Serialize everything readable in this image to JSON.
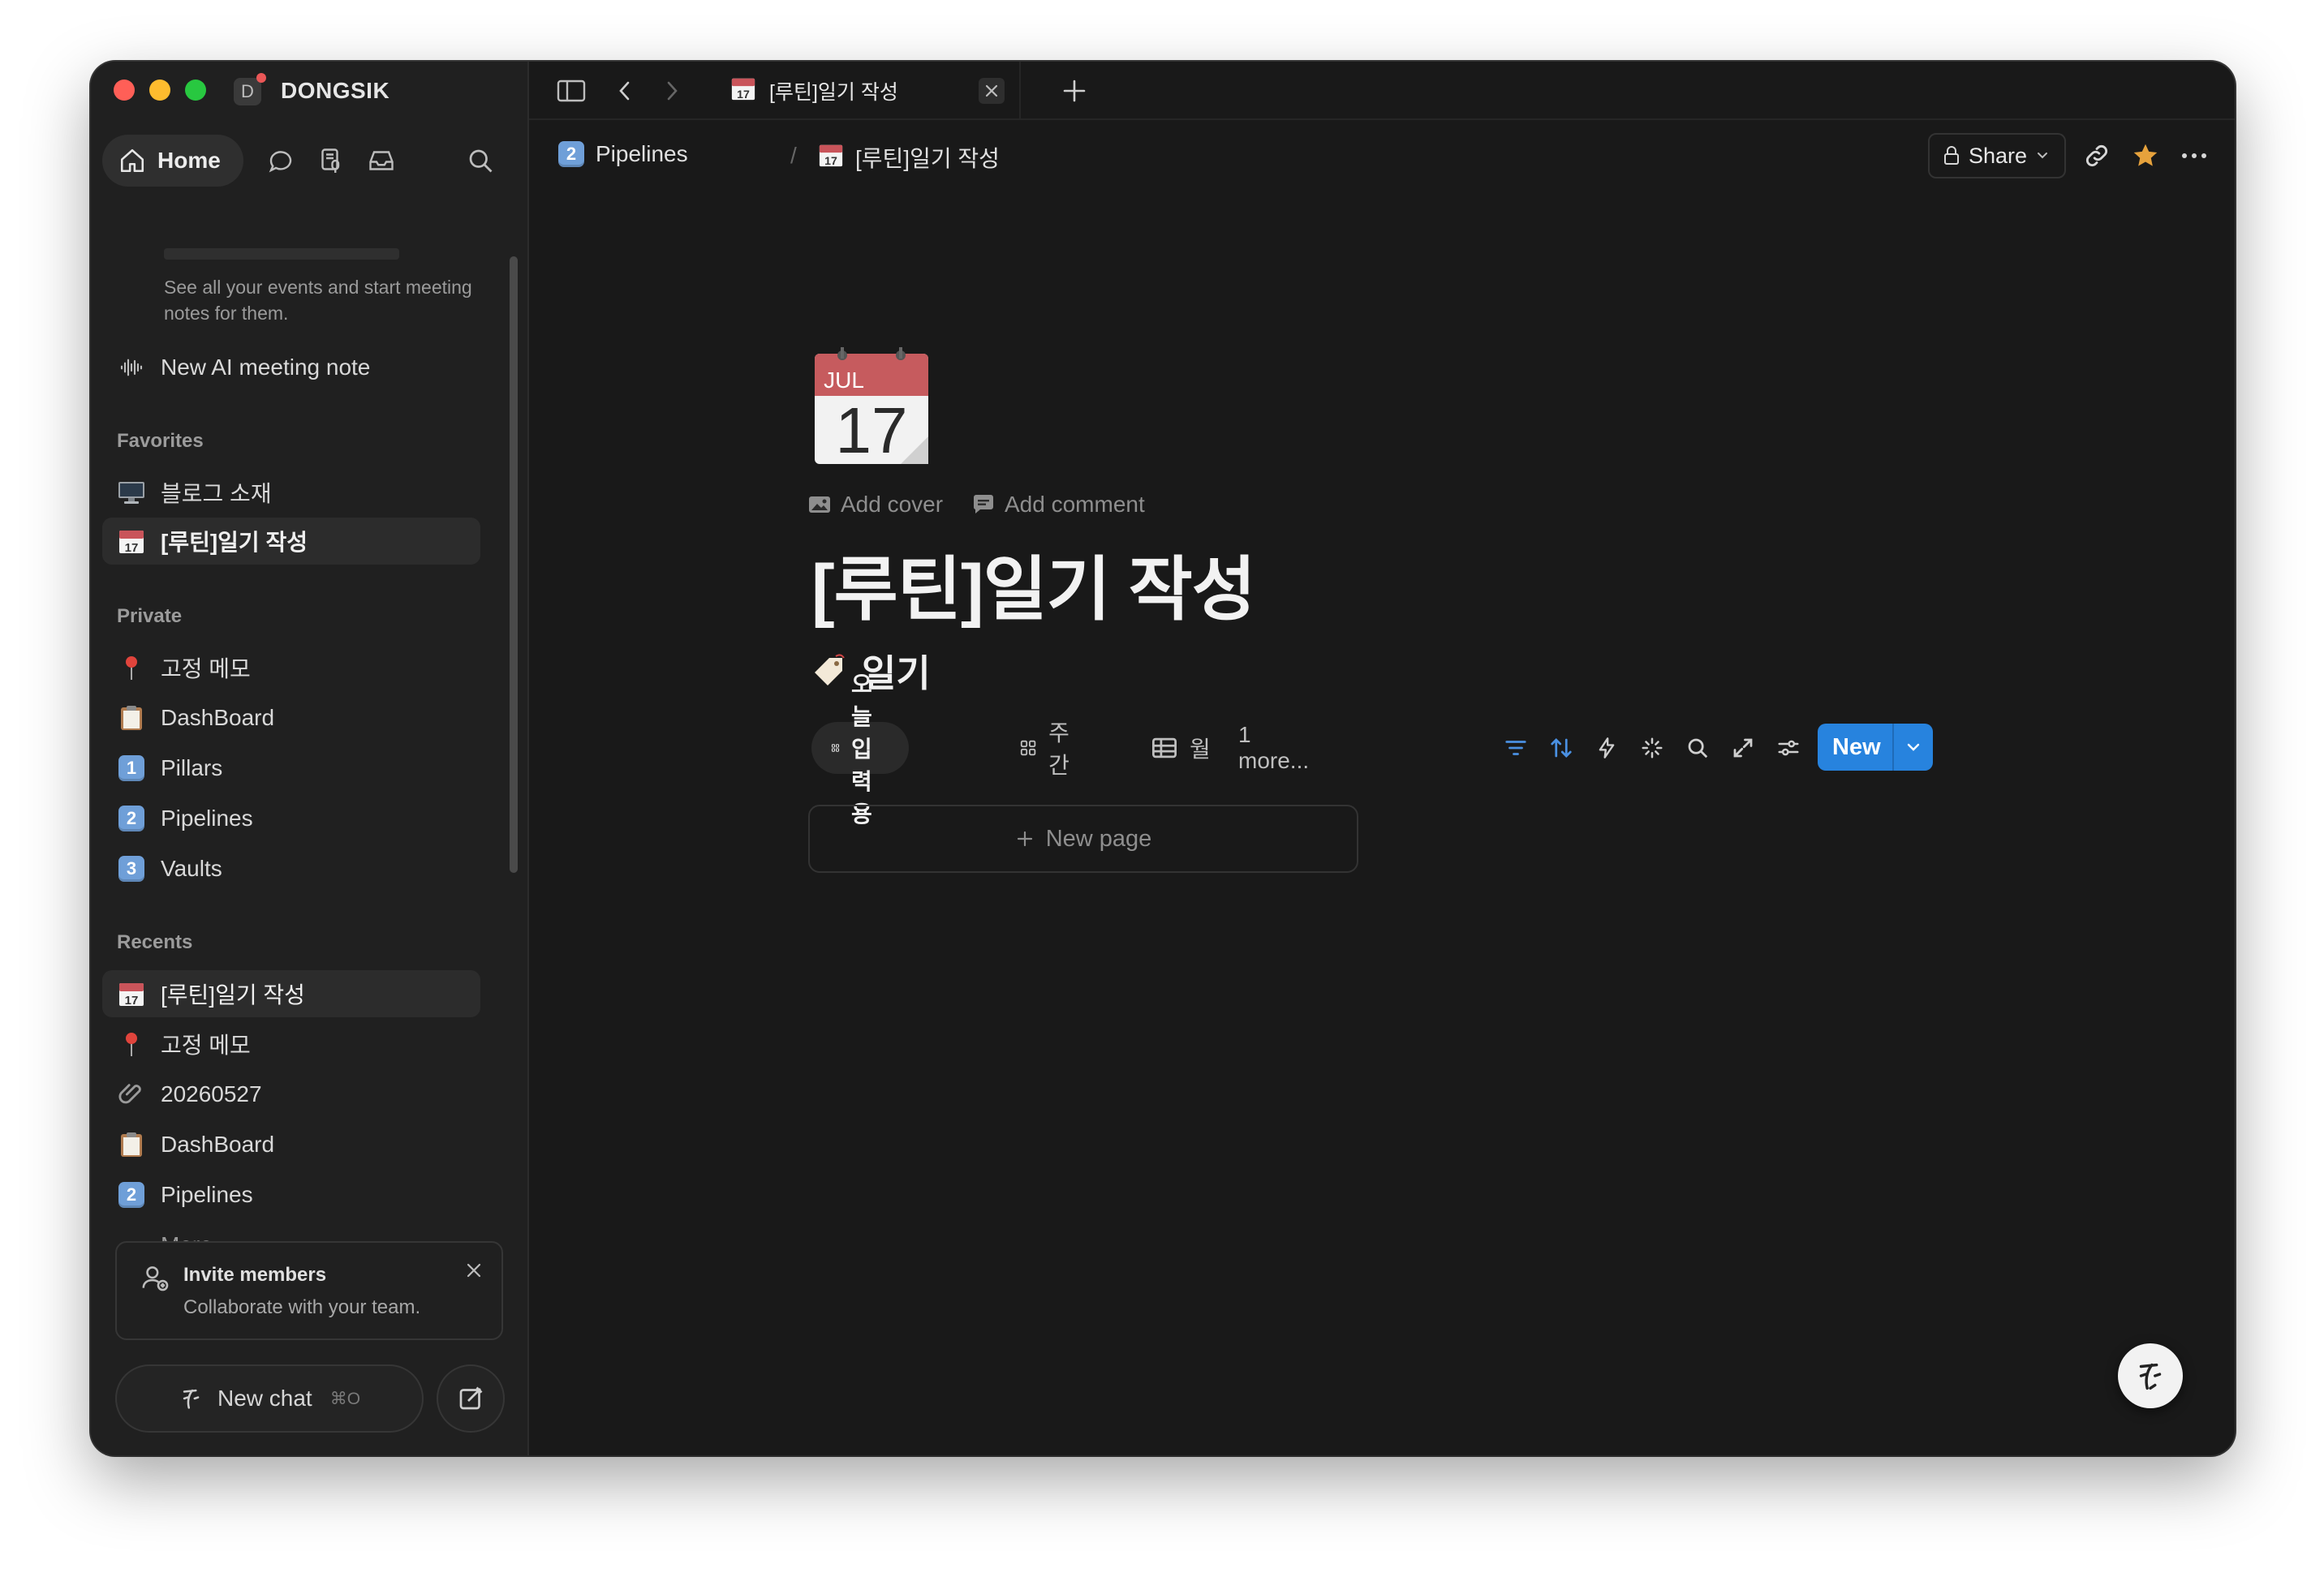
{
  "workspace": {
    "initial": "D",
    "name": "DONGSIK"
  },
  "sidebar": {
    "home_label": "Home",
    "meeting_desc": "See all your events and start meeting notes for them.",
    "ai_meeting_label": "New AI meeting note",
    "favorites_heading": "Favorites",
    "favorites": [
      {
        "label": "블로그 소재",
        "icon": "desktop-computer-icon"
      },
      {
        "label": "[루틴]일기 작성",
        "icon": "calendar-icon"
      }
    ],
    "private_heading": "Private",
    "private": [
      {
        "label": "고정 메모",
        "icon": "pushpin-icon"
      },
      {
        "label": "DashBoard",
        "icon": "clipboard-icon"
      },
      {
        "label": "Pillars",
        "badge": "1"
      },
      {
        "label": "Pipelines",
        "badge": "2"
      },
      {
        "label": "Vaults",
        "badge": "3"
      }
    ],
    "recents_heading": "Recents",
    "recents": [
      {
        "label": "[루틴]일기 작성",
        "icon": "calendar-icon"
      },
      {
        "label": "고정 메모",
        "icon": "pushpin-icon"
      },
      {
        "label": "20260527",
        "icon": "paperclip-icon"
      },
      {
        "label": "DashBoard",
        "icon": "clipboard-icon"
      },
      {
        "label": "Pipelines",
        "badge": "2"
      }
    ],
    "more_label": "More",
    "invite": {
      "title": "Invite members",
      "subtitle": "Collaborate with your team."
    },
    "new_chat": {
      "label": "New chat",
      "shortcut": "⌘O"
    }
  },
  "tabbar": {
    "tab_title": "[루틴]일기 작성"
  },
  "breadcrumb": [
    {
      "label": "Pipelines",
      "badge": "2"
    },
    {
      "label": "[루틴]일기 작성"
    }
  ],
  "topbar": {
    "share_label": "Share"
  },
  "page": {
    "calendar_month": "JUL",
    "calendar_day": "17",
    "add_cover": "Add cover",
    "add_comment": "Add comment",
    "title": "[루틴]일기 작성",
    "database_title": "일기"
  },
  "views": {
    "tabs": [
      {
        "label": "오늘 입력용",
        "icon": "gallery-icon",
        "active": true
      },
      {
        "label": "주간",
        "icon": "gallery-icon",
        "active": false
      },
      {
        "label": "월",
        "icon": "table-icon",
        "active": false
      }
    ],
    "more_label": "1 more...",
    "new_button": "New",
    "new_page_label": "New page"
  },
  "colors": {
    "accent": "#2783de",
    "filter_icon": "#4a90e2",
    "favorite_star": "#e6a23c"
  }
}
